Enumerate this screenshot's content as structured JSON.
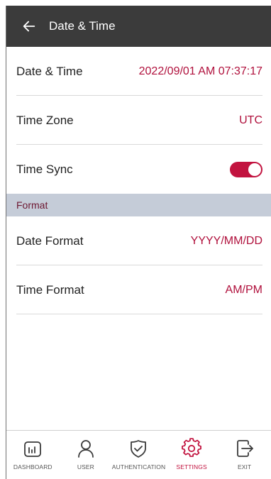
{
  "header": {
    "title": "Date & Time"
  },
  "rows": [
    {
      "label": "Date & Time",
      "value": "2022/09/01 AM 07:37:17"
    },
    {
      "label": "Time Zone",
      "value": "UTC"
    },
    {
      "label": "Time Sync",
      "toggle_on": true
    }
  ],
  "section": {
    "title": "Format"
  },
  "format_rows": [
    {
      "label": "Date Format",
      "value": "YYYY/MM/DD"
    },
    {
      "label": "Time Format",
      "value": "AM/PM"
    }
  ],
  "bottom_nav": [
    {
      "label": "DASHBOARD",
      "icon": "dashboard-icon",
      "active": false
    },
    {
      "label": "USER",
      "icon": "user-icon",
      "active": false
    },
    {
      "label": "AUTHENTICATION",
      "icon": "shield-check-icon",
      "active": false
    },
    {
      "label": "SETTINGS",
      "icon": "gear-icon",
      "active": true
    },
    {
      "label": "EXIT",
      "icon": "exit-icon",
      "active": false
    }
  ],
  "colors": {
    "app_bar": "#3b3b3b",
    "accent": "#c2133f",
    "value_text": "#b0103c",
    "section_bg": "#c5ccd8"
  }
}
